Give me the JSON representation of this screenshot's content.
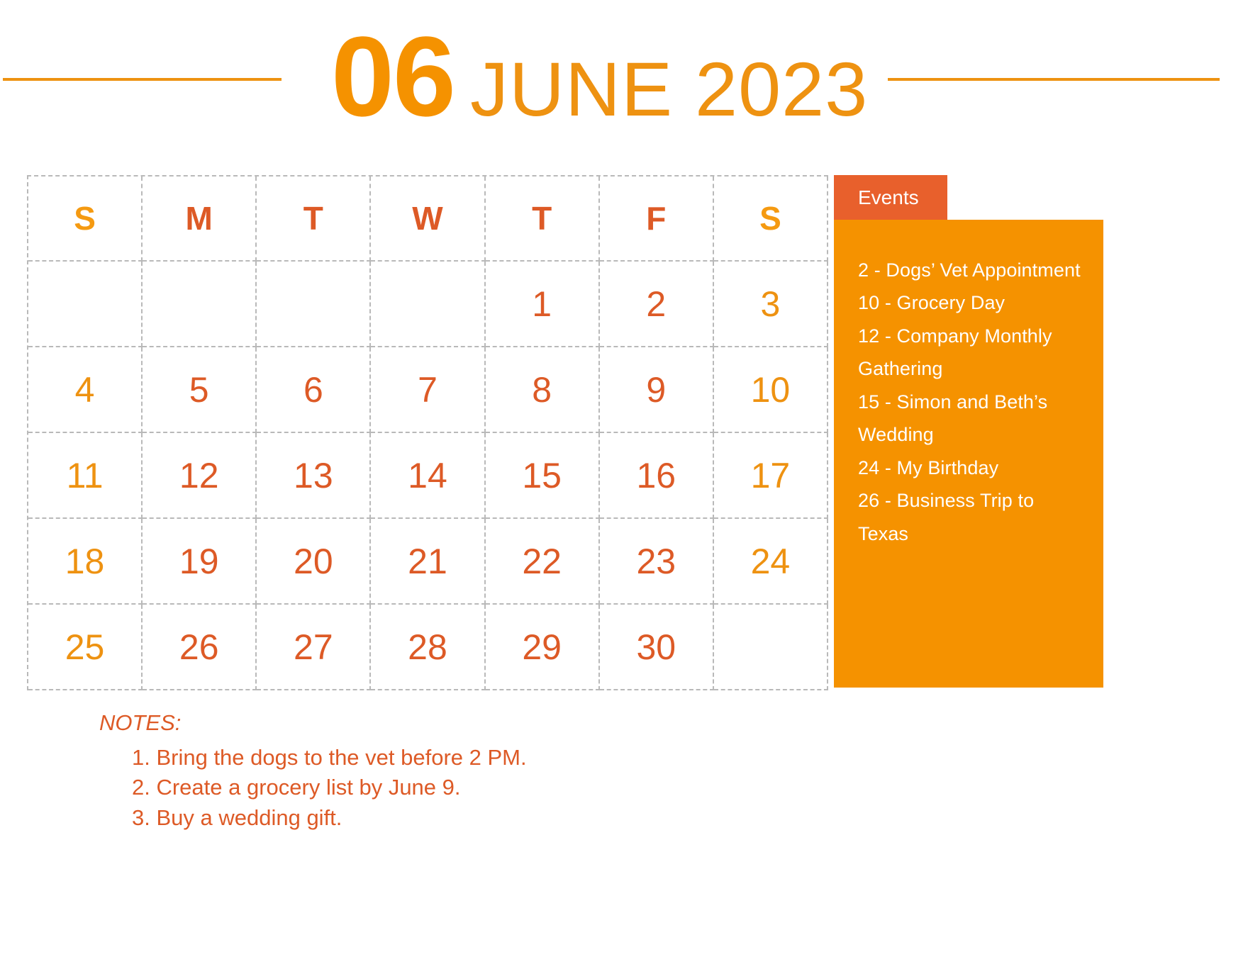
{
  "header": {
    "month_number": "06",
    "month_year": "JUNE 2023",
    "accent_color": "#F59200",
    "rule_color": "#EE9211"
  },
  "calendar": {
    "weekday_headers": [
      {
        "label": "S",
        "weekend": true
      },
      {
        "label": "M",
        "weekend": false
      },
      {
        "label": "T",
        "weekend": false
      },
      {
        "label": "W",
        "weekend": false
      },
      {
        "label": "T",
        "weekend": false
      },
      {
        "label": "F",
        "weekend": false
      },
      {
        "label": "S",
        "weekend": true
      }
    ],
    "weeks": [
      [
        {
          "day": "",
          "weekend": true
        },
        {
          "day": "",
          "weekend": false
        },
        {
          "day": "",
          "weekend": false
        },
        {
          "day": "",
          "weekend": false
        },
        {
          "day": "1",
          "weekend": false
        },
        {
          "day": "2",
          "weekend": false
        },
        {
          "day": "3",
          "weekend": true
        }
      ],
      [
        {
          "day": "4",
          "weekend": true
        },
        {
          "day": "5",
          "weekend": false
        },
        {
          "day": "6",
          "weekend": false
        },
        {
          "day": "7",
          "weekend": false
        },
        {
          "day": "8",
          "weekend": false
        },
        {
          "day": "9",
          "weekend": false
        },
        {
          "day": "10",
          "weekend": true
        }
      ],
      [
        {
          "day": "11",
          "weekend": true
        },
        {
          "day": "12",
          "weekend": false
        },
        {
          "day": "13",
          "weekend": false
        },
        {
          "day": "14",
          "weekend": false
        },
        {
          "day": "15",
          "weekend": false
        },
        {
          "day": "16",
          "weekend": false
        },
        {
          "day": "17",
          "weekend": true
        }
      ],
      [
        {
          "day": "18",
          "weekend": true
        },
        {
          "day": "19",
          "weekend": false
        },
        {
          "day": "20",
          "weekend": false
        },
        {
          "day": "21",
          "weekend": false
        },
        {
          "day": "22",
          "weekend": false
        },
        {
          "day": "23",
          "weekend": false
        },
        {
          "day": "24",
          "weekend": true
        }
      ],
      [
        {
          "day": "25",
          "weekend": true
        },
        {
          "day": "26",
          "weekend": false
        },
        {
          "day": "27",
          "weekend": false
        },
        {
          "day": "28",
          "weekend": false
        },
        {
          "day": "29",
          "weekend": false
        },
        {
          "day": "30",
          "weekend": false
        },
        {
          "day": "",
          "weekend": true
        }
      ]
    ],
    "weekday_color": "#DD5A26",
    "weekend_color": "#F59A11",
    "grid_line_color": "#b9b9b9"
  },
  "events": {
    "tab_label": "Events",
    "tab_color": "#E8602C",
    "panel_color": "#F59200",
    "items": [
      "2 - Dogs’ Vet Appointment",
      "10 - Grocery Day",
      "12 - Company Monthly Gathering",
      "15 - Simon and Beth’s Wedding",
      "24 - My Birthday",
      "26 - Business Trip to Texas"
    ]
  },
  "notes": {
    "title": "NOTES:",
    "items": [
      "1. Bring the dogs to the vet before 2 PM.",
      "2. Create a grocery list by June 9.",
      "3. Buy a wedding gift."
    ],
    "color": "#DD5A26"
  }
}
